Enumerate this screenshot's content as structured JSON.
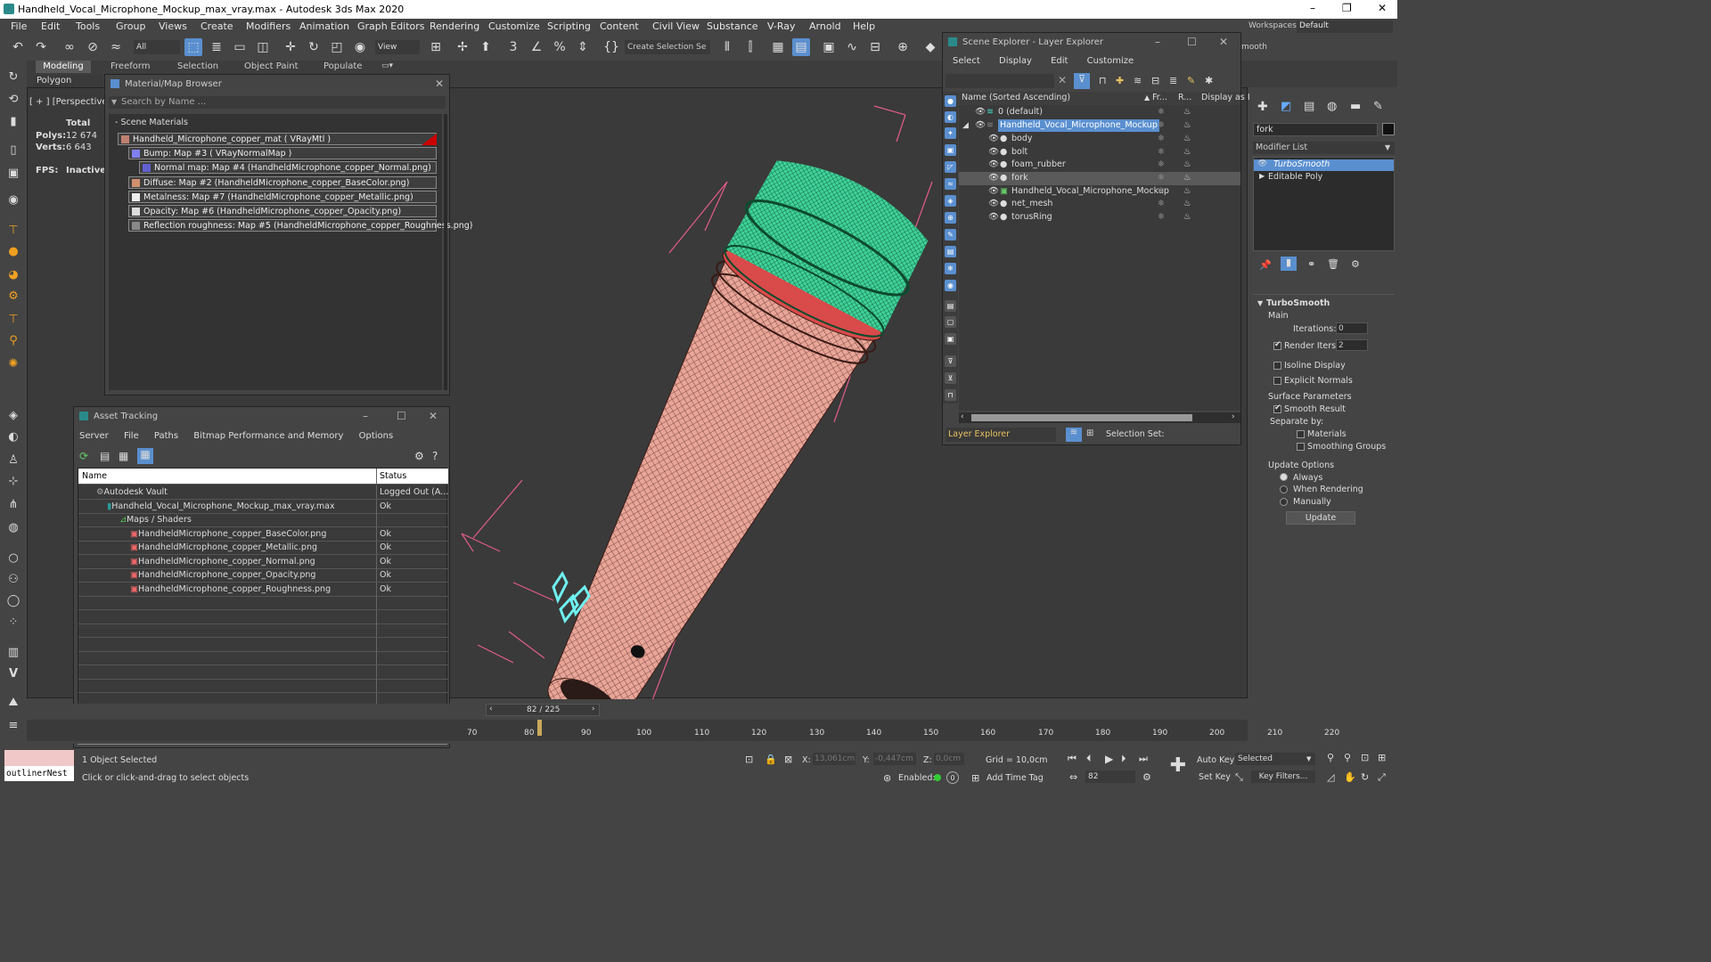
{
  "window": {
    "title": "Handheld_Vocal_Microphone_Mockup_max_vray.max - Autodesk 3ds Max 2020",
    "minimize": "–",
    "maximize": "❐",
    "close": "✕"
  },
  "menu": [
    "File",
    "Edit",
    "Tools",
    "Group",
    "Views",
    "Create",
    "Modifiers",
    "Animation",
    "Graph Editors",
    "Rendering",
    "Customize",
    "Scripting",
    "Content",
    "Civil View",
    "Substance",
    "V-Ray",
    "Arnold",
    "Help"
  ],
  "toolbar": {
    "filter_value": "All",
    "view_value": "View",
    "selection_set_placeholder": "Create Selection Se",
    "workspaces_label": "Workspaces:",
    "workspaces_value": "Default",
    "smooth_text": "mooth"
  },
  "ribbon": {
    "tabs": [
      "Modeling",
      "Freeform",
      "Selection",
      "Object Paint",
      "Populate"
    ],
    "sub_label": "Polygon Modelin"
  },
  "viewport": {
    "label": "[ + ] [Perspective ] [ S",
    "stats": {
      "total_label": "Total",
      "polys_label": "Polys:",
      "polys_value": "12 674",
      "verts_label": "Verts:",
      "verts_value": "6 643",
      "fps_label": "FPS:",
      "fps_value": "Inactive"
    }
  },
  "material_browser": {
    "title": "Material/Map Browser",
    "search_placeholder": "Search by Name ...",
    "section": "- Scene Materials",
    "items": [
      "Handheld_Microphone_copper_mat  ( VRayMtl )",
      "Bump: Map #3  ( VRayNormalMap )",
      "Normal map: Map #4 (HandheldMicrophone_copper_Normal.png)",
      "Diffuse: Map #2 (HandheldMicrophone_copper_BaseColor.png)",
      "Metalness: Map #7 (HandheldMicrophone_copper_Metallic.png)",
      "Opacity: Map #6 (HandheldMicrophone_copper_Opacity.png)",
      "Reflection roughness: Map #5 (HandheldMicrophone_copper_Roughness.png)"
    ]
  },
  "asset_tracking": {
    "title": "Asset Tracking",
    "menu": [
      "Server",
      "File",
      "Paths",
      "Bitmap Performance and Memory",
      "Options"
    ],
    "col_name": "Name",
    "col_status": "Status",
    "rows": [
      {
        "name": "Autodesk Vault",
        "status": "Logged Out (A..."
      },
      {
        "name": "Handheld_Vocal_Microphone_Mockup_max_vray.max",
        "status": "Ok"
      },
      {
        "name": "Maps / Shaders",
        "status": ""
      },
      {
        "name": "HandheldMicrophone_copper_BaseColor.png",
        "status": "Ok"
      },
      {
        "name": "HandheldMicrophone_copper_Metallic.png",
        "status": "Ok"
      },
      {
        "name": "HandheldMicrophone_copper_Normal.png",
        "status": "Ok"
      },
      {
        "name": "HandheldMicrophone_copper_Opacity.png",
        "status": "Ok"
      },
      {
        "name": "HandheldMicrophone_copper_Roughness.png",
        "status": "Ok"
      }
    ]
  },
  "scene_explorer": {
    "title": "Scene Explorer - Layer Explorer",
    "menu": [
      "Select",
      "Display",
      "Edit",
      "Customize"
    ],
    "col_name": "Name (Sorted Ascending)",
    "col_fr": "Fr...",
    "col_r": "R...",
    "col_display": "Display as I",
    "rows": [
      {
        "name": "0 (default)",
        "level": 0
      },
      {
        "name": "Handheld_Vocal_Microphone_Mockup",
        "level": 0
      },
      {
        "name": "body",
        "level": 1
      },
      {
        "name": "bolt",
        "level": 1
      },
      {
        "name": "foam_rubber",
        "level": 1
      },
      {
        "name": "fork",
        "level": 1
      },
      {
        "name": "Handheld_Vocal_Microphone_Mockup",
        "level": 1
      },
      {
        "name": "net_mesh",
        "level": 1
      },
      {
        "name": "torusRing",
        "level": 1
      }
    ],
    "bottom_dropdown": "Layer Explorer",
    "selection_set_label": "Selection Set:"
  },
  "command_panel": {
    "object_name": "fork",
    "modifier_list": "Modifier List",
    "stack": [
      "TurboSmooth",
      "Editable Poly"
    ],
    "rollout_title": "TurboSmooth",
    "main_label": "Main",
    "iterations_label": "Iterations:",
    "iterations_value": "0",
    "render_iters_label": "Render Iters:",
    "render_iters_value": "2",
    "isoline_label": "Isoline Display",
    "explicit_label": "Explicit Normals",
    "surface_params_label": "Surface Parameters",
    "smooth_result_label": "Smooth Result",
    "separate_by_label": "Separate by:",
    "materials_label": "Materials",
    "smoothing_groups_label": "Smoothing Groups",
    "update_options_label": "Update Options",
    "always_label": "Always",
    "when_rendering_label": "When Rendering",
    "manually_label": "Manually",
    "update_button": "Update"
  },
  "timeline": {
    "frame_display": "82 / 225",
    "ticks": [
      "70",
      "80",
      "90",
      "100",
      "110",
      "120",
      "130",
      "140",
      "150",
      "160",
      "170",
      "180",
      "190",
      "200",
      "210",
      "220"
    ]
  },
  "status": {
    "maxscript_text": "outlinerNest",
    "selected_text": "1 Object Selected",
    "prompt_text": "Click or click-and-drag to select objects",
    "x_label": "X:",
    "x_value": "13,061cm",
    "y_label": "Y:",
    "y_value": "-0,447cm",
    "z_label": "Z:",
    "z_value": "0,0cm",
    "grid_text": "Grid = 10,0cm",
    "enabled_label": "Enabled:",
    "add_time_tag": "Add Time Tag",
    "auto_key": "Auto Key",
    "set_key": "Set Key",
    "selected_dropdown": "Selected",
    "key_filters": "Key Filters...",
    "frame_value": "82"
  },
  "colors": {
    "accent": "#5a8fcf",
    "wire_copper": "#e8a598",
    "wire_green": "#3fd39a",
    "bbox_pink": "#e25d8b"
  }
}
